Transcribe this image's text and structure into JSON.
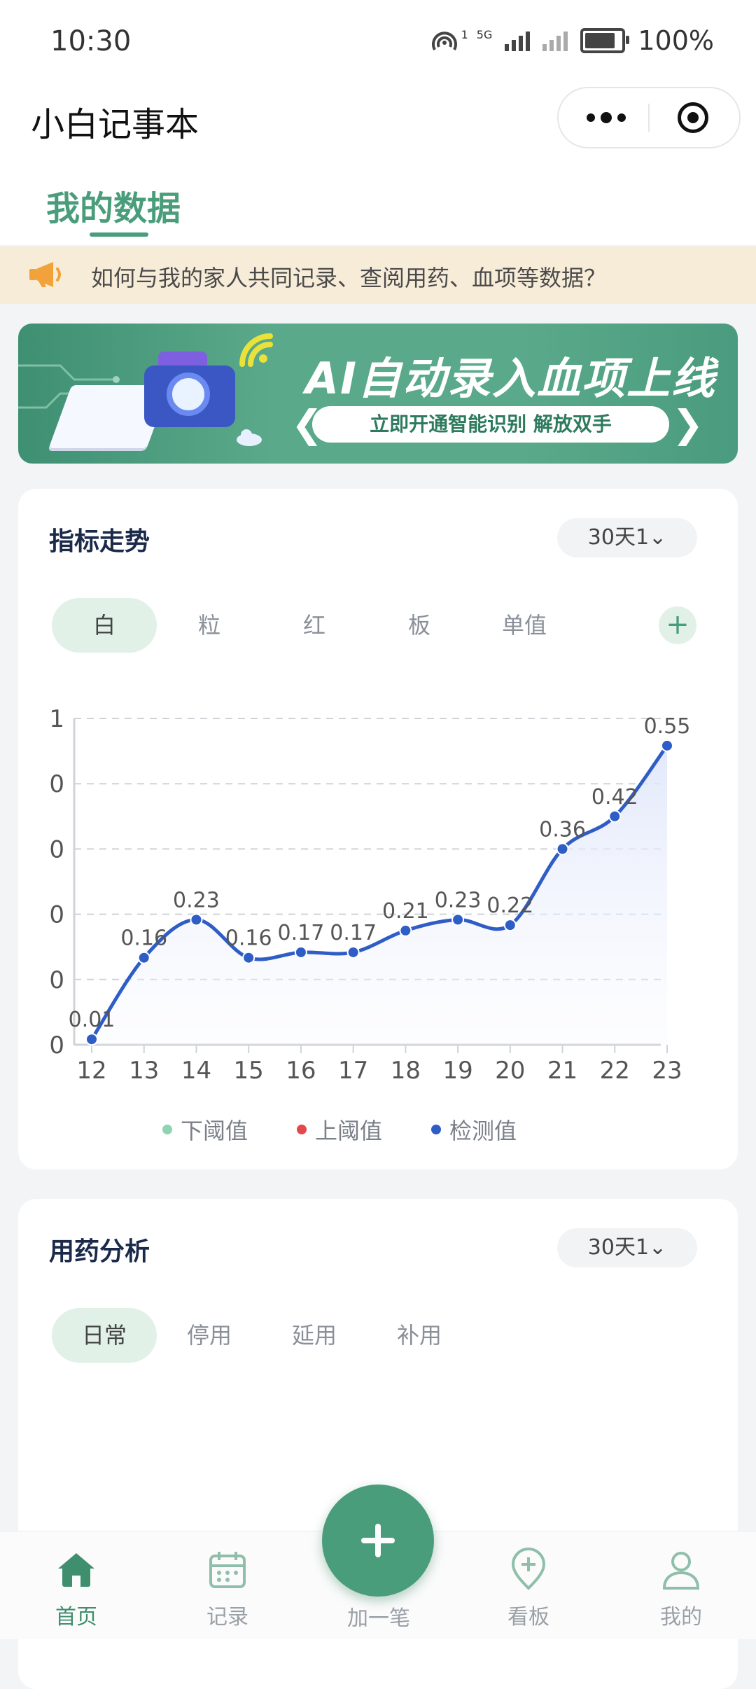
{
  "status_bar": {
    "time": "10:30",
    "battery": "100%",
    "battery_level": 1.0,
    "signal_labels": [
      "1",
      "5G"
    ]
  },
  "app": {
    "title": "小白记事本"
  },
  "tabs": [
    {
      "label": "我的数据",
      "active": true
    }
  ],
  "notice": {
    "text": "如何与我的家人共同记录、查阅用药、血项等数据？",
    "icon": "megaphone-icon"
  },
  "banner": {
    "title": "AI自动录入血项上线",
    "subtitle": "立即开通智能识别 解放双手"
  },
  "trend_card": {
    "title": "指标走势",
    "range": "30天1⌄",
    "segments": [
      "白",
      "粒",
      "红",
      "板",
      "单值"
    ],
    "active_segment": 0,
    "add_label": "+",
    "legend": [
      {
        "label": "下阈值",
        "color": "#8fd3b0"
      },
      {
        "label": "上阈值",
        "color": "#e2484c"
      },
      {
        "label": "检测值",
        "color": "#2f5dc6"
      }
    ]
  },
  "chart_data": {
    "type": "line",
    "x": [
      "12",
      "13",
      "14",
      "15",
      "16",
      "17",
      "18",
      "19",
      "20",
      "21",
      "22",
      "23"
    ],
    "series": [
      {
        "name": "检测值",
        "values": [
          0.01,
          0.16,
          0.23,
          0.16,
          0.17,
          0.17,
          0.21,
          0.23,
          0.22,
          0.36,
          0.42,
          0.55
        ],
        "color": "#2f5dc6"
      }
    ],
    "data_labels": [
      "0.01",
      "0.16",
      "0.23",
      "0.16",
      "0.17",
      "0.17",
      "0.21",
      "0.23",
      "0.22",
      "0.36",
      "0.42",
      "0.55"
    ],
    "y_tick_labels": [
      "0",
      "0",
      "0",
      "0",
      "0",
      "1"
    ],
    "ylim": [
      0,
      0.6
    ],
    "grid": true,
    "smooth": true,
    "area_fill": true
  },
  "med_card": {
    "title": "用药分析",
    "range": "30天1⌄",
    "segments": [
      "日常",
      "停用",
      "延用",
      "补用"
    ],
    "active_segment": 0
  },
  "bottom_nav": {
    "items": [
      {
        "label": "首页",
        "icon": "home-icon",
        "active": true
      },
      {
        "label": "记录",
        "icon": "calendar-icon",
        "active": false
      },
      {
        "label": "加一笔",
        "icon": "plus-icon",
        "active": false
      },
      {
        "label": "看板",
        "icon": "location-plus-icon",
        "active": false
      },
      {
        "label": "我的",
        "icon": "user-icon",
        "active": false
      }
    ]
  },
  "colors": {
    "accent": "#4a9d7a",
    "line": "#2f5dc6",
    "notice_bg": "#f7ecd8"
  }
}
